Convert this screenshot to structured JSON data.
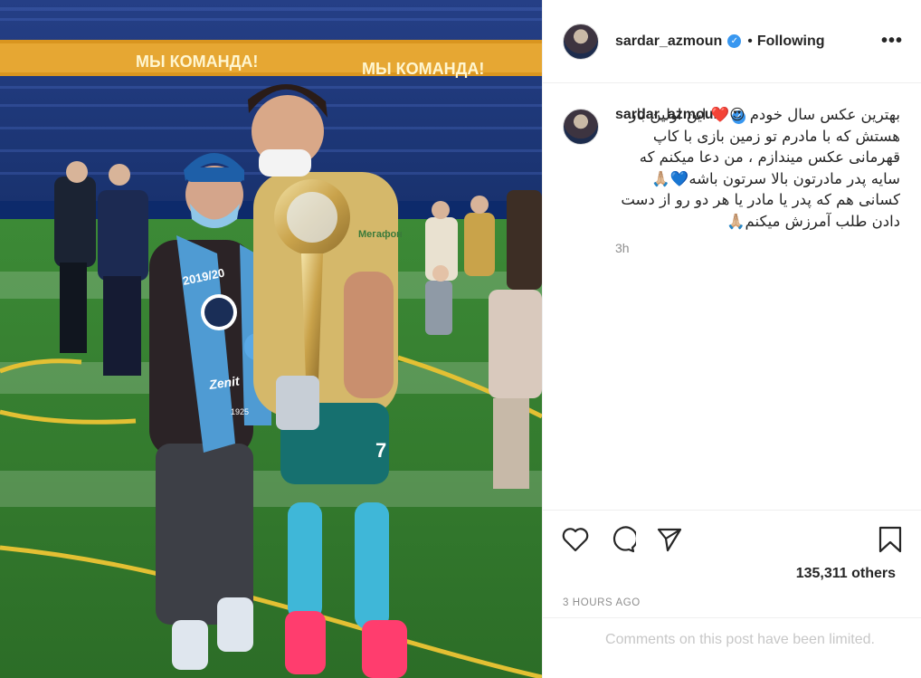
{
  "post": {
    "image": {
      "banner_text_left": "МЫ КОМАНДА!",
      "banner_text_right": "МЫ КОМАНДА!",
      "scarf_text": "2019/20",
      "scarf_brand": "Zenit",
      "scarf_year": "1925",
      "shirt_sponsor": "Мегафон",
      "shirt_number": "7",
      "pitch_color": "#2e7d2e",
      "stand_color": "#1c3fa3"
    }
  },
  "header": {
    "username": "sardar_azmoun",
    "verified_icon": "verified-badge-icon",
    "separator": "•",
    "follow_label": "Following",
    "more_label": "•••"
  },
  "caption": {
    "username": "sardar_azmoun",
    "text": "بهترین عکس سال خودم 😍❤️ این اولین بار هستش که با مادرم تو زمین بازی با کاپ قهرمانی عکس میندازم ، من دعا میکنم که سایه پدر مادرتون بالا سرتون باشه💙🙏🏼 کسانی هم که پدر یا مادر یا هر دو رو از دست دادن طلب آمرزش میکنم🙏🏼",
    "time": "3h"
  },
  "actions": {
    "like_icon": "heart-icon",
    "comment_icon": "comment-icon",
    "share_icon": "share-icon",
    "save_icon": "bookmark-icon",
    "likes_text": "135,311 others",
    "timestamp": "3 HOURS AGO",
    "comments_limited": "Comments on this post have been limited."
  },
  "colors": {
    "text_primary": "#262626",
    "text_secondary": "#8e8e8e",
    "verified": "#3897f0",
    "border": "#efefef",
    "muted": "#c7c7c7"
  }
}
